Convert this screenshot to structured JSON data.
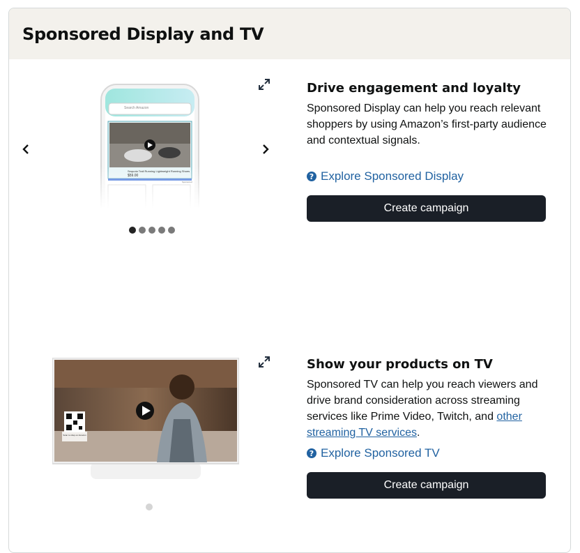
{
  "card": {
    "title": "Sponsored Display and TV"
  },
  "display": {
    "heading": "Drive engagement and loyalty",
    "description": "Sponsored Display can help you reach relevant shoppers by using Amazon’s first-party audience and contextual signals.",
    "explore_label": "Explore Sponsored Display",
    "button_label": "Create campaign",
    "phone": {
      "search_placeholder": "Search Amazon",
      "product_title": "Sequoia Trail Running Lightweight Running Shoes",
      "product_price": "$59.00",
      "sponsored_label": "Sponsored"
    },
    "carousel_dots": 5,
    "active_dot": 0
  },
  "tv": {
    "heading": "Show your products on TV",
    "description_prefix": "Sponsored TV can help you reach viewers and drive brand consideration across streaming services like Prime Video, Twitch, and ",
    "description_link": "other streaming TV services",
    "description_suffix": ".",
    "explore_label": "Explore Sponsored TV",
    "button_label": "Create campaign",
    "qr_caption": "Scan to shop on Amazon",
    "carousel_dots": 1
  },
  "icons": {
    "prev": "chevron-left-icon",
    "next": "chevron-right-icon",
    "expand": "expand-icon",
    "help": "question-circle-icon",
    "play": "play-icon"
  }
}
